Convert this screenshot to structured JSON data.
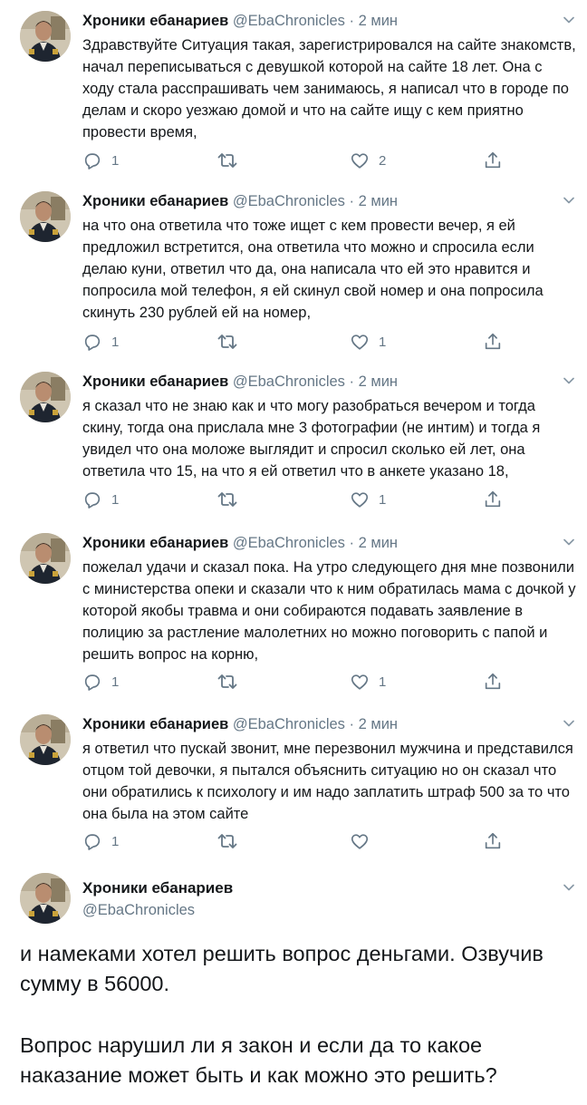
{
  "author": {
    "name": "Хроники ебанариев",
    "handle": "@EbaChronicles"
  },
  "tweets": [
    {
      "meta": "@EbaChronicles · 2 мин",
      "text": "Здравствуйте Ситуация такая, зарегистрировался на сайте знакомств, начал переписываться с девушкой которой на сайте 18 лет. Она с ходу стала расспрашивать чем занимаюсь, я написал что в городе по делам и скоро уезжаю домой и что на сайте ищу с кем приятно провести время,",
      "replies": "1",
      "retweets": "",
      "likes": "2"
    },
    {
      "meta": "@EbaChronicles · 2 мин",
      "text": "на что она ответила что тоже ищет с кем провести вечер, я ей предложил встретится, она ответила что можно и спросила если делаю куни, ответил что да, она написала что ей это нравится и попросила мой телефон, я ей скинул свой номер и она попросила скинуть 230 рублей ей на номер,",
      "replies": "1",
      "retweets": "",
      "likes": "1"
    },
    {
      "meta": "@EbaChronicles · 2 мин",
      "text": "я сказал что не знаю как и что могу разобраться вечером и тогда скину, тогда она прислала мне 3 фотографии (не интим) и тогда я увидел что она моложе выглядит и спросил сколько ей лет, она ответила что 15, на что я ей ответил что в анкете указано 18,",
      "replies": "1",
      "retweets": "",
      "likes": "1"
    },
    {
      "meta": "@EbaChronicles · 2 мин",
      "text": "пожелал удачи и сказал пока. На утро следующего дня мне позвонили с министерства опеки и сказали что к ним обратилась мама с дочкой у которой якобы травма и они собираются подавать заявление в полицию за растление малолетних но можно поговорить с папой и решить вопрос на корню,",
      "replies": "1",
      "retweets": "",
      "likes": "1"
    },
    {
      "meta": "@EbaChronicles · 2 мин",
      "text": "я ответил что пускай звонит, мне перезвонил мужчина и представился отцом той девочки, я пытался объяснить ситуацию но он сказал что они обратились к психологу и им надо заплатить штраф 500 за то что она была на этом сайте",
      "replies": "1",
      "retweets": "",
      "likes": ""
    }
  ],
  "final_tweet": {
    "name": "Хроники ебанариев",
    "handle": "@EbaChronicles",
    "paragraph1": "и намеками хотел решить вопрос деньгами. Озвучив сумму в 56000.",
    "paragraph2": "Вопрос нарушил ли я закон и если да то какое наказание может быть и как можно это решить?"
  },
  "icons": {
    "reply": "reply-icon",
    "retweet": "retweet-icon",
    "like": "heart-icon",
    "share": "share-icon",
    "more": "chevron-down-icon"
  },
  "colors": {
    "text": "#14171a",
    "muted": "#657786",
    "icon": "#657786"
  }
}
